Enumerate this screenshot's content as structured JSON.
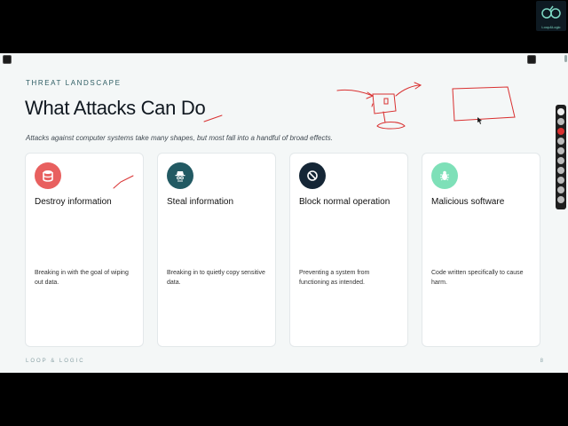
{
  "slide": {
    "eyebrow": "THREAT LANDSCAPE",
    "title": "What Attacks Can Do",
    "subtitle": "Attacks against computer systems take many shapes, but most fall into a handful of broad effects.",
    "footer_brand": "LOOP & LOGIC",
    "page_number": "8"
  },
  "cards": [
    {
      "title": "Destroy information",
      "description": "Breaking in with the goal of wiping out data.",
      "icon": "database-icon",
      "icon_color": "#e8605f"
    },
    {
      "title": "Steal information",
      "description": "Breaking in to quietly copy sensitive data.",
      "icon": "spy-icon",
      "icon_color": "#225a63"
    },
    {
      "title": "Block normal operation",
      "description": "Preventing a system from functioning as intended.",
      "icon": "block-icon",
      "icon_color": "#152636"
    },
    {
      "title": "Malicious software",
      "description": "Code written specifically to cause harm.",
      "icon": "bug-icon",
      "icon_color": "#7ee0b8"
    }
  ],
  "logo": {
    "text": "Loop&Logic"
  },
  "colors": {
    "accent": "#2e5d63",
    "annotation": "#d93030",
    "slide_bg": "#f4f7f7"
  }
}
